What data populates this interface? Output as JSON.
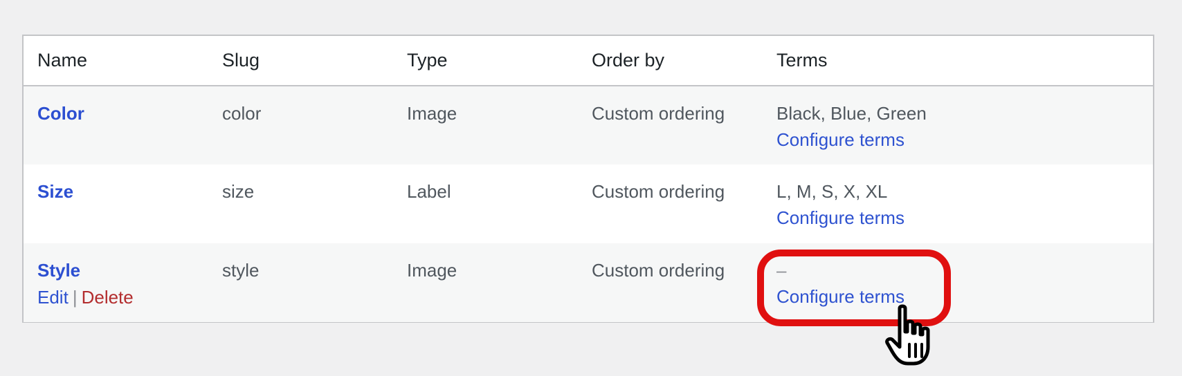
{
  "table": {
    "headers": [
      "Name",
      "Slug",
      "Type",
      "Order by",
      "Terms"
    ],
    "rows": [
      {
        "name": "Color",
        "slug": "color",
        "type": "Image",
        "order_by": "Custom ordering",
        "terms": "Black, Blue, Green",
        "configure": "Configure terms"
      },
      {
        "name": "Size",
        "slug": "size",
        "type": "Label",
        "order_by": "Custom ordering",
        "terms": "L, M, S, X, XL",
        "configure": "Configure terms"
      },
      {
        "name": "Style",
        "slug": "style",
        "type": "Image",
        "order_by": "Custom ordering",
        "terms": "–",
        "configure": "Configure terms",
        "actions": {
          "edit": "Edit",
          "separator": "|",
          "delete": "Delete"
        }
      }
    ]
  },
  "colors": {
    "link": "#2e52d0",
    "danger": "#b32d2e",
    "highlight": "#e01010"
  },
  "icons": {
    "cursor": "hand-pointer-icon"
  }
}
